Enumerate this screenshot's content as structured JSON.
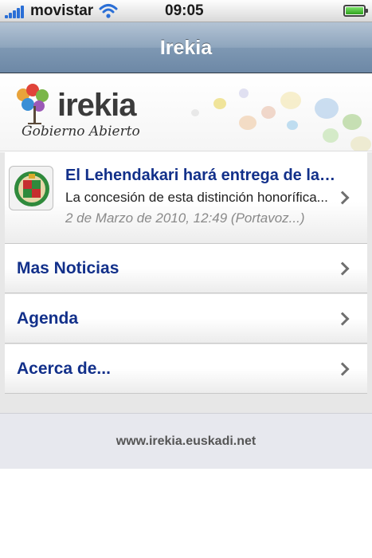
{
  "status_bar": {
    "carrier": "movistar",
    "time": "09:05",
    "signal_bars": 5,
    "battery_level": 1.0,
    "icons": [
      "signal-icon",
      "wifi-icon",
      "battery-icon"
    ]
  },
  "nav": {
    "title": "Irekia"
  },
  "banner": {
    "logo_text": "irekia",
    "logo_tagline": "Gobierno Abierto"
  },
  "news": {
    "title": "El Lehendakari hará entrega de las Medallas...",
    "summary": "La concesión de esta distinción honorífica...",
    "meta": "2 de Marzo de 2010, 12:49 (Portavoz...)",
    "thumb_icon": "coat-of-arms-icon"
  },
  "menu": {
    "items": [
      {
        "label": "Mas Noticias"
      },
      {
        "label": "Agenda"
      },
      {
        "label": "Acerca de..."
      }
    ]
  },
  "footer": {
    "url": "www.irekia.euskadi.net"
  },
  "colors": {
    "link_blue": "#12308a",
    "nav_blue": "#7e98b3",
    "background_gray": "#e7e7e7"
  }
}
